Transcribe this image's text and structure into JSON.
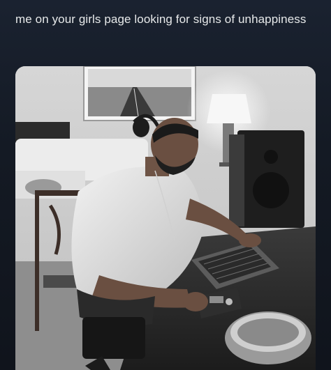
{
  "post": {
    "caption": "me on your girls page looking for signs of unhappiness",
    "media_icon": "photo",
    "colors": {
      "background": "#151b25",
      "text": "#e7e9ea"
    }
  }
}
